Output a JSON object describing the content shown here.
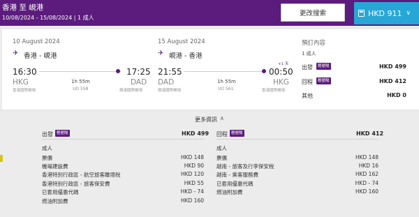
{
  "header": {
    "route": "香港 至 峴港",
    "subtitle": "10/08/2024 - 15/08/2024 | 1 成人",
    "change_button": "更改搜索",
    "total_label": "HKD 911",
    "total_chevron": "∨"
  },
  "outbound": {
    "date": "10 August 2024",
    "route": "香港 - 峴港",
    "dep_time": "16:30",
    "arr_time": "17:25",
    "dep_code": "HKG",
    "arr_code": "DAD",
    "dep_airport": "香港國際機場",
    "arr_airport": "峴港國際機場",
    "duration": "1h 55m",
    "flight": "UO 558"
  },
  "inbound": {
    "date": "15 August 2024",
    "route": "峴港 - 香港",
    "dep_time": "21:55",
    "arr_time": "00:50",
    "day_offset": "+1 天",
    "dep_code": "DAD",
    "arr_code": "HKG",
    "dep_airport": "峴港國際機場",
    "arr_airport": "香港國際機場",
    "duration": "1h 55m",
    "flight": "UO 561"
  },
  "summary": {
    "title": "預訂內容",
    "pax": "1 成人",
    "outbound_label": "出發",
    "outbound_fare": "輕便陽",
    "outbound_amount": "HKD 499",
    "inbound_label": "回程",
    "inbound_fare": "輕便陽",
    "inbound_amount": "HKD 412",
    "other_label": "其他",
    "other_amount": "HKD 0"
  },
  "more_info": {
    "label": "更多資訊",
    "chevron": "∧"
  },
  "detail_out": {
    "label": "出發",
    "fare": "輕便陽",
    "amount": "HKD 499",
    "pax": "成人",
    "rows": [
      {
        "label": "票價",
        "amount": "HKD 148"
      },
      {
        "label": "機場建設費",
        "amount": "HKD 90"
      },
      {
        "label": "香港特別行政區 - 航空旅客離境稅",
        "amount": "HKD 120"
      },
      {
        "label": "香港特別行政區 - 旅客保安費",
        "amount": "HKD 55"
      },
      {
        "label": "已套用優惠代碼",
        "amount": "HKD - 74"
      },
      {
        "label": "燃油附加費",
        "amount": "HKD 160"
      }
    ]
  },
  "detail_in": {
    "label": "回程",
    "fare": "輕便陽",
    "amount": "HKD 412",
    "pax": "成人",
    "rows": [
      {
        "label": "票價",
        "amount": "HKD 148"
      },
      {
        "label": "越南 - 旅客及行李保安稅",
        "amount": "HKD 16"
      },
      {
        "label": "越南 - 乘客服務費",
        "amount": "HKD 162"
      },
      {
        "label": "已套用優惠代碼",
        "amount": "HKD - 74"
      },
      {
        "label": "燃油附加費",
        "amount": "HKD 160"
      }
    ]
  },
  "colors": {
    "brand": "#5b1c7d",
    "accent": "#27a7d6"
  }
}
